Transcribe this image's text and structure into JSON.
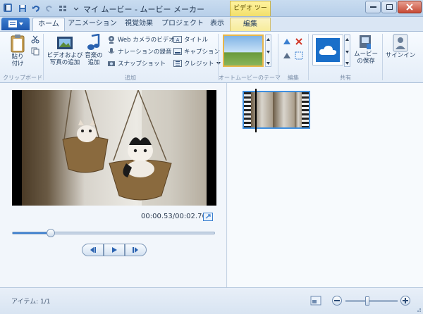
{
  "window": {
    "title": "マイ ムービー - ムービー メーカー",
    "context_tab_title": "ビデオ ツール"
  },
  "tabs": [
    {
      "label": "ホーム",
      "active": true
    },
    {
      "label": "アニメーション"
    },
    {
      "label": "視覚効果"
    },
    {
      "label": "プロジェクト"
    },
    {
      "label": "表示"
    },
    {
      "label": "編集",
      "context": true
    }
  ],
  "ribbon": {
    "clipboard": {
      "paste_label": "貼り\n付け",
      "group_label": "クリップボード"
    },
    "add": {
      "add_videos_label": "ビデオおよび\n写真の追加",
      "add_music_label": "音楽の\n追加",
      "webcam_label": "Web カメラのビデオ",
      "narration_label": "ナレーションの録音",
      "snapshot_label": "スナップショット",
      "title_label": "タイトル",
      "caption_label": "キャプション",
      "credits_label": "クレジット",
      "group_label": "追加"
    },
    "themes": {
      "group_label": "オートムービーのテーマ"
    },
    "editing": {
      "group_label": "編集"
    },
    "share": {
      "save_movie_label": "ムービー\nの保存",
      "group_label": "共有"
    },
    "signin": {
      "label": "サインイン"
    }
  },
  "preview": {
    "time_readout": "00:00.53/00:02.76",
    "seek_progress": 0.19
  },
  "status": {
    "items_text": "アイテム: 1/1",
    "zoom_level": 0.42
  },
  "colors": {
    "accent": "#3a7fd0",
    "ribbon_bg": "#f7fbff",
    "context_tab": "#f2df6a",
    "close_red": "#c74a35"
  },
  "icons": {
    "app": "movie-maker-icon",
    "save": "save-icon",
    "undo": "undo-icon",
    "redo": "redo-icon",
    "help": "help-icon"
  }
}
